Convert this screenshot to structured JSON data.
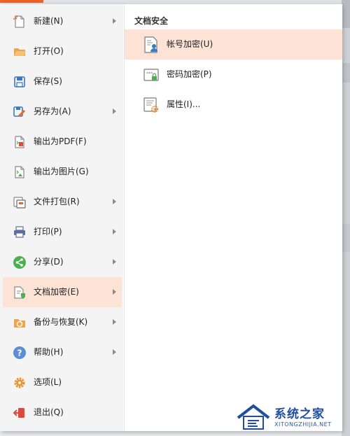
{
  "menu": {
    "left_items": [
      {
        "label": "新建(N)",
        "icon": "new-file-icon",
        "has_submenu": true
      },
      {
        "label": "打开(O)",
        "icon": "open-folder-icon",
        "has_submenu": false
      },
      {
        "label": "保存(S)",
        "icon": "save-icon",
        "has_submenu": false
      },
      {
        "label": "另存为(A)",
        "icon": "save-as-icon",
        "has_submenu": true
      },
      {
        "label": "输出为PDF(F)",
        "icon": "export-pdf-icon",
        "has_submenu": false
      },
      {
        "label": "输出为图片(G)",
        "icon": "export-image-icon",
        "has_submenu": false
      },
      {
        "label": "文件打包(R)",
        "icon": "package-icon",
        "has_submenu": true
      },
      {
        "label": "打印(P)",
        "icon": "print-icon",
        "has_submenu": true
      },
      {
        "label": "分享(D)",
        "icon": "share-icon",
        "has_submenu": true
      },
      {
        "label": "文档加密(E)",
        "icon": "encrypt-document-icon",
        "has_submenu": true
      },
      {
        "label": "备份与恢复(K)",
        "icon": "backup-restore-icon",
        "has_submenu": true
      },
      {
        "label": "帮助(H)",
        "icon": "help-icon",
        "has_submenu": true
      },
      {
        "label": "选项(L)",
        "icon": "options-gear-icon",
        "has_submenu": false
      },
      {
        "label": "退出(Q)",
        "icon": "exit-icon",
        "has_submenu": false
      }
    ],
    "active_left_index": 9,
    "submenu": {
      "title": "文档安全",
      "items": [
        {
          "label": "帐号加密(U)",
          "icon": "account-encrypt-icon"
        },
        {
          "label": "密码加密(P)",
          "icon": "password-encrypt-icon"
        },
        {
          "label": "属性(I)...",
          "icon": "properties-icon"
        }
      ],
      "active_index": 0
    }
  },
  "watermark": {
    "name": "系统之家",
    "url": "XITONGZHIJIA.NET"
  },
  "colors": {
    "accent": "#e8642a",
    "highlight": "#fde3d6",
    "brand_blue": "#1e4f9e"
  }
}
